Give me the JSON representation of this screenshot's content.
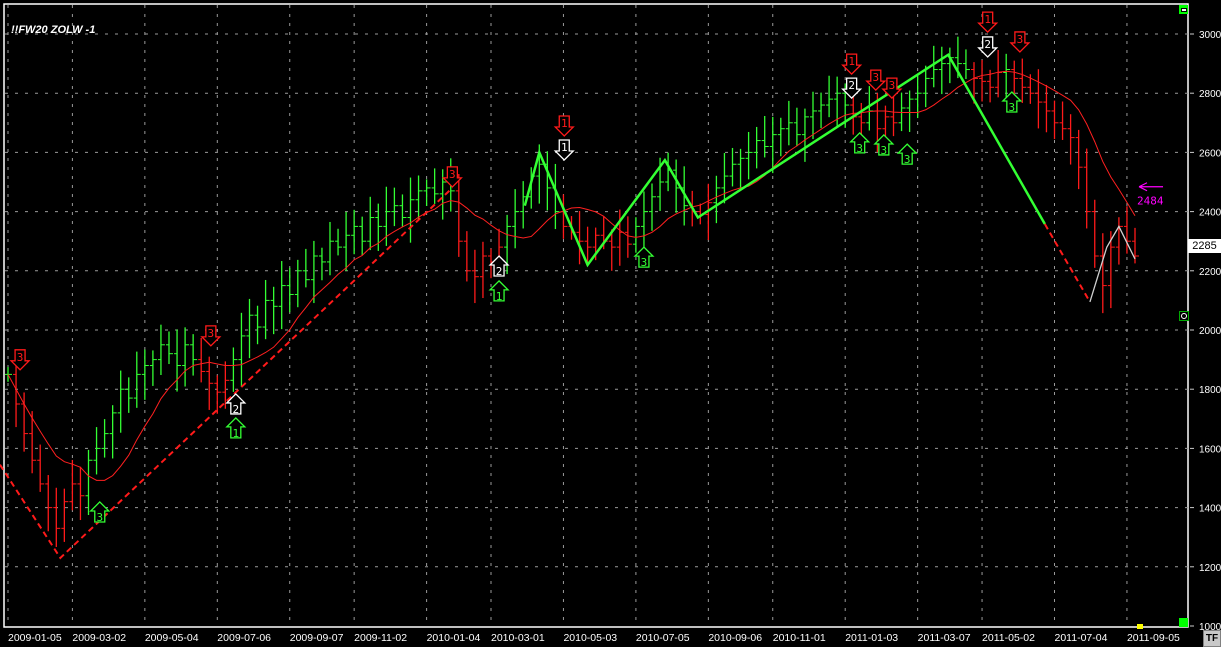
{
  "title": "!!FW20 ZOLW -1",
  "last_price": "2285",
  "tf_button": "TF",
  "colors": {
    "up": "#33ff33",
    "down": "#ff1a1a",
    "ma": "#ff2020",
    "grid": "#9a9a9a",
    "target": "#ff00ff",
    "zigzag_green": "#33ff33",
    "zigzag_red": "#ff1a1a"
  },
  "chart_data": {
    "type": "ohlc",
    "title": "!!FW20 ZOLW -1",
    "interval": "weekly",
    "ylim": [
      1000,
      3000
    ],
    "y_ticks": [
      1000,
      1200,
      1400,
      1600,
      1800,
      2000,
      2200,
      2400,
      2600,
      2800,
      3000
    ],
    "x_ticks": [
      {
        "i": 0,
        "label": "2009-01-05"
      },
      {
        "i": 8,
        "label": "2009-03-02"
      },
      {
        "i": 17,
        "label": "2009-05-04"
      },
      {
        "i": 26,
        "label": "2009-07-06"
      },
      {
        "i": 35,
        "label": "2009-09-07"
      },
      {
        "i": 43,
        "label": "2009-11-02"
      },
      {
        "i": 52,
        "label": "2010-01-04"
      },
      {
        "i": 60,
        "label": "2010-03-01"
      },
      {
        "i": 69,
        "label": "2010-05-03"
      },
      {
        "i": 78,
        "label": "2010-07-05"
      },
      {
        "i": 87,
        "label": "2010-09-06"
      },
      {
        "i": 95,
        "label": "2010-11-01"
      },
      {
        "i": 104,
        "label": "2011-01-03"
      },
      {
        "i": 113,
        "label": "2011-03-07"
      },
      {
        "i": 121,
        "label": "2011-05-02"
      },
      {
        "i": 130,
        "label": "2011-07-04"
      },
      {
        "i": 139,
        "label": "2011-09-05"
      }
    ],
    "closes": [
      1850,
      1750,
      1650,
      1560,
      1480,
      1400,
      1330,
      1420,
      1480,
      1440,
      1560,
      1600,
      1650,
      1720,
      1800,
      1770,
      1850,
      1880,
      1900,
      1950,
      1920,
      1880,
      1950,
      1900,
      1860,
      1820,
      1790,
      1830,
      1900,
      1980,
      2050,
      2010,
      2100,
      2080,
      2150,
      2120,
      2200,
      2170,
      2250,
      2230,
      2300,
      2280,
      2320,
      2350,
      2300,
      2380,
      2350,
      2400,
      2420,
      2380,
      2440,
      2470,
      2480,
      2460,
      2500,
      2470,
      2300,
      2200,
      2180,
      2250,
      2230,
      2280,
      2350,
      2400,
      2450,
      2520,
      2560,
      2480,
      2400,
      2350,
      2330,
      2300,
      2280,
      2320,
      2300,
      2280,
      2330,
      2290,
      2350,
      2400,
      2450,
      2500,
      2540,
      2480,
      2420,
      2400,
      2390,
      2430,
      2480,
      2520,
      2560,
      2580,
      2600,
      2640,
      2620,
      2660,
      2680,
      2700,
      2660,
      2720,
      2740,
      2760,
      2780,
      2800,
      2760,
      2720,
      2700,
      2740,
      2680,
      2720,
      2700,
      2750,
      2780,
      2800,
      2850,
      2880,
      2900,
      2920,
      2900,
      2880,
      2850,
      2840,
      2820,
      2870,
      2880,
      2850,
      2820,
      2800,
      2770,
      2740,
      2700,
      2680,
      2650,
      2550,
      2400,
      2250,
      2150,
      2280,
      2350,
      2300,
      2250
    ],
    "ma_period": 10,
    "zigzag": [
      {
        "style": "red-dashed",
        "points": [
          [
            -1,
            1545
          ],
          [
            6.5,
            1230
          ],
          [
            55.2,
            2480
          ]
        ]
      },
      {
        "style": "green",
        "points": [
          [
            64.2,
            2420
          ],
          [
            66,
            2600
          ],
          [
            72,
            2220
          ],
          [
            81.6,
            2574
          ],
          [
            85.7,
            2380
          ],
          [
            116.8,
            2930
          ],
          [
            128.8,
            2358
          ]
        ]
      },
      {
        "style": "red-dashed",
        "points": [
          [
            128.8,
            2358
          ],
          [
            134.4,
            2095
          ]
        ]
      },
      {
        "style": "white",
        "points": [
          [
            134.4,
            2095
          ],
          [
            136.5,
            2280
          ],
          [
            138,
            2350
          ],
          [
            140,
            2240
          ]
        ]
      }
    ],
    "signals": [
      {
        "i": 1.5,
        "p": 1933,
        "dir": "down",
        "label": "3",
        "color": "red"
      },
      {
        "i": 11.4,
        "p": 1419,
        "dir": "up",
        "label": "3",
        "color": "green"
      },
      {
        "i": 25.2,
        "p": 2014,
        "dir": "down",
        "label": "3",
        "color": "red"
      },
      {
        "i": 28.3,
        "p": 1784,
        "dir": "up",
        "label": "2",
        "color": "white"
      },
      {
        "i": 28.3,
        "p": 1703,
        "dir": "up",
        "label": "1",
        "color": "green"
      },
      {
        "i": 55.2,
        "p": 2551,
        "dir": "down",
        "label": "3",
        "color": "red"
      },
      {
        "i": 61,
        "p": 2250,
        "dir": "up",
        "label": "2",
        "color": "white"
      },
      {
        "i": 61,
        "p": 2166,
        "dir": "up",
        "label": "1",
        "color": "green"
      },
      {
        "i": 69.1,
        "p": 2723,
        "dir": "down",
        "label": "1",
        "color": "red"
      },
      {
        "i": 69.1,
        "p": 2642,
        "dir": "down",
        "label": "1",
        "color": "white"
      },
      {
        "i": 79,
        "p": 2280,
        "dir": "up",
        "label": "3",
        "color": "green"
      },
      {
        "i": 104.8,
        "p": 2932,
        "dir": "down",
        "label": "1",
        "color": "red"
      },
      {
        "i": 104.8,
        "p": 2851,
        "dir": "down",
        "label": "2",
        "color": "white"
      },
      {
        "i": 107.8,
        "p": 2878,
        "dir": "down",
        "label": "3",
        "color": "red"
      },
      {
        "i": 109.8,
        "p": 2851,
        "dir": "down",
        "label": "3",
        "color": "red"
      },
      {
        "i": 105.8,
        "p": 2666,
        "dir": "up",
        "label": "3",
        "color": "green"
      },
      {
        "i": 108.8,
        "p": 2659,
        "dir": "up",
        "label": "3",
        "color": "green"
      },
      {
        "i": 111.7,
        "p": 2628,
        "dir": "up",
        "label": "3",
        "color": "green"
      },
      {
        "i": 121.7,
        "p": 3074,
        "dir": "down",
        "label": "1",
        "color": "red"
      },
      {
        "i": 121.7,
        "p": 2990,
        "dir": "down",
        "label": "2",
        "color": "white"
      },
      {
        "i": 125.7,
        "p": 3007,
        "dir": "down",
        "label": "3",
        "color": "red"
      },
      {
        "i": 124.7,
        "p": 2804,
        "dir": "up",
        "label": "3",
        "color": "green"
      }
    ],
    "target": {
      "i": 140.5,
      "p": 2484,
      "label": "2484"
    }
  }
}
